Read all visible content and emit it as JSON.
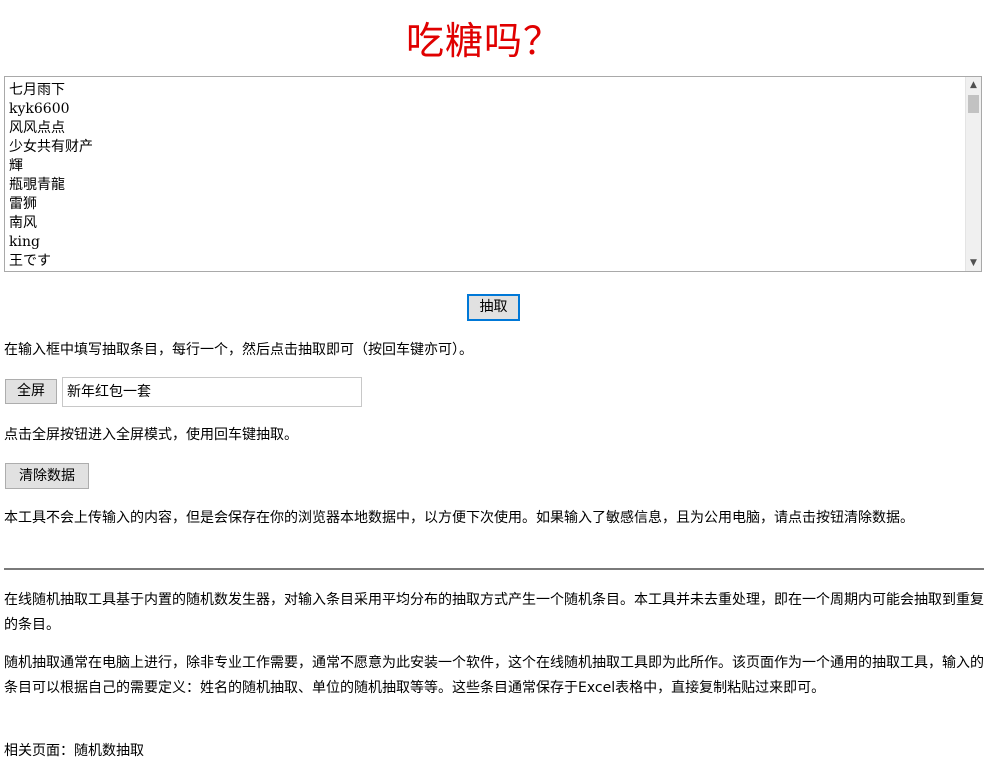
{
  "title": "吃糖吗？",
  "entries": "七月雨下\nkyk6600\n风风点点\n少女共有财产\n輝\n瓶覗青龍\n雷狮\n南风\nking\n王です",
  "buttons": {
    "draw": "抽取",
    "fullscreen": "全屏",
    "clear": "清除数据"
  },
  "prize_input_value": "新年红包一套",
  "instructions": {
    "input_hint": "在输入框中填写抽取条目，每行一个，然后点击抽取即可（按回车键亦可）。",
    "fullscreen_hint": "点击全屏按钮进入全屏模式，使用回车键抽取。",
    "privacy_note": "本工具不会上传输入的内容，但是会保存在你的浏览器本地数据中，以方便下次使用。如果输入了敏感信息，且为公用电脑，请点击按钮清除数据。"
  },
  "description": {
    "p1": "在线随机抽取工具基于内置的随机数发生器，对输入条目采用平均分布的抽取方式产生一个随机条目。本工具并未去重处理，即在一个周期内可能会抽取到重复的条目。",
    "p2": "随机抽取通常在电脑上进行，除非专业工作需要，通常不愿意为此安装一个软件，这个在线随机抽取工具即为此所作。该页面作为一个通用的抽取工具，输入的条目可以根据自己的需要定义：姓名的随机抽取、单位的随机抽取等等。这些条目通常保存于Excel表格中，直接复制粘贴过来即可。"
  },
  "related": {
    "label": "相关页面：",
    "link": "随机数抽取"
  },
  "colors": {
    "title": "#e00000",
    "focus_border": "#0078d7"
  }
}
